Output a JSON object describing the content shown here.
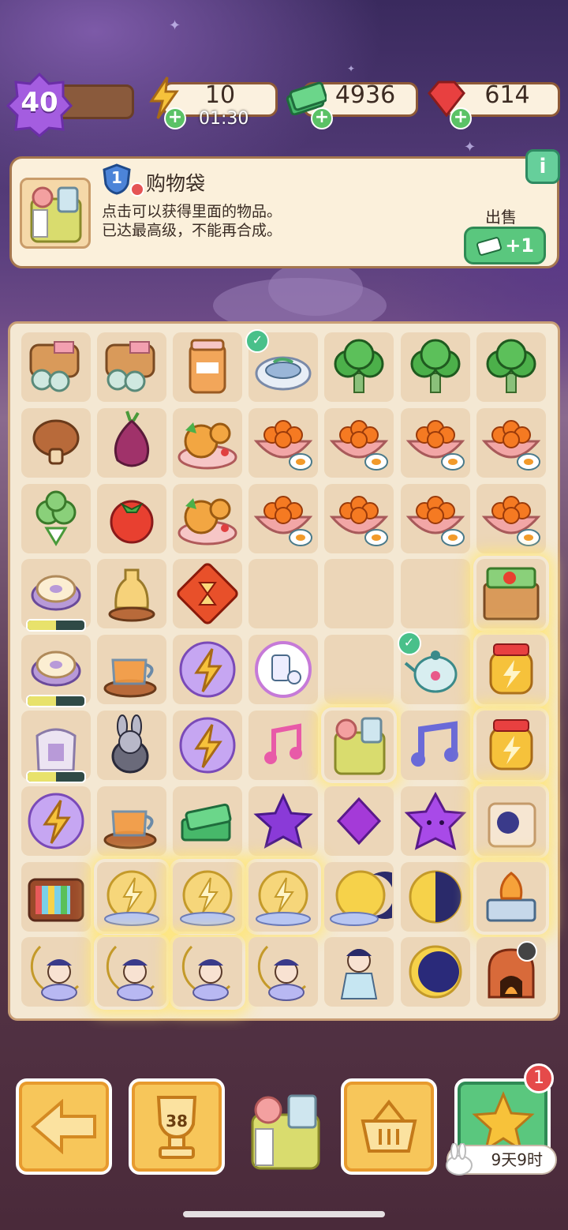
{
  "hud": {
    "level": "40",
    "energy": "10",
    "energy_timer": "01:30",
    "cash": "4936",
    "gems": "614"
  },
  "info_panel": {
    "tier": "1",
    "title": "购物袋",
    "desc_line1": "点击可以获得里面的物品。",
    "desc_line2": "已达最高级，不能再合成。",
    "sell_label": "出售",
    "sell_value": "+1",
    "info_button": "i"
  },
  "board": {
    "rows": [
      [
        "toast-eggs",
        "toast-eggs",
        "jar-rousong",
        "fish-plate",
        "broccoli",
        "broccoli",
        "broccoli"
      ],
      [
        "mushroom",
        "onion",
        "mooncake-plate",
        "orange-egg-bowl",
        "orange-egg-bowl",
        "orange-egg-bowl",
        "orange-egg-bowl"
      ],
      [
        "cauliflower",
        "tomato",
        "mooncake-plate",
        "orange-egg-bowl",
        "orange-egg-bowl",
        "orange-egg-bowl",
        "orange-egg-bowl"
      ],
      [
        "donut-generator",
        "oil-bottle",
        "hourglass-token",
        "",
        "",
        "",
        "vegetable-crate"
      ],
      [
        "donut-generator",
        "teapot-glass",
        "energy-bubble",
        "milk-bubble",
        "",
        "teapot-floral",
        "energy-jar"
      ],
      [
        "flour-sack",
        "rabbit-chef",
        "energy-bubble",
        "music-note-pink",
        "shopping-bag",
        "music-note-blue",
        "energy-jar"
      ],
      [
        "energy-bubble",
        "teapot-glass",
        "cash-pile",
        "star-purple",
        "gem-purple",
        "star-face-purple",
        "fairy-chest"
      ],
      [
        "tv-generator",
        "golden-energy-cloud",
        "golden-energy-cloud",
        "golden-energy-cloud",
        "moon-cloud",
        "moon-half",
        "energy-stove"
      ],
      [
        "fairy-moon",
        "fairy-moon",
        "fairy-moon",
        "fairy-moon",
        "fairy-girl",
        "moon-crescent",
        "clay-oven"
      ]
    ],
    "progress": {
      "3-0": 0.5,
      "4-0": 0.5,
      "5-0": 0.5
    },
    "checked": [
      "0-3",
      "4-5"
    ],
    "glowing": [
      "3-6",
      "4-6",
      "5-4",
      "5-6",
      "6-6",
      "7-1",
      "7-2",
      "7-3",
      "7-6",
      "8-1",
      "8-2"
    ]
  },
  "bottom": {
    "back_icon": "arrow-left-icon",
    "trophy_count": "38",
    "basket_icon": "basket-icon",
    "star_badge": "1",
    "timer": "9天9时"
  },
  "colors": {
    "board_bg": "#f4e8d3",
    "cell_bg": "#ecd6b8",
    "button_yellow": "#f7c65a",
    "sell_green": "#5ac77e"
  }
}
